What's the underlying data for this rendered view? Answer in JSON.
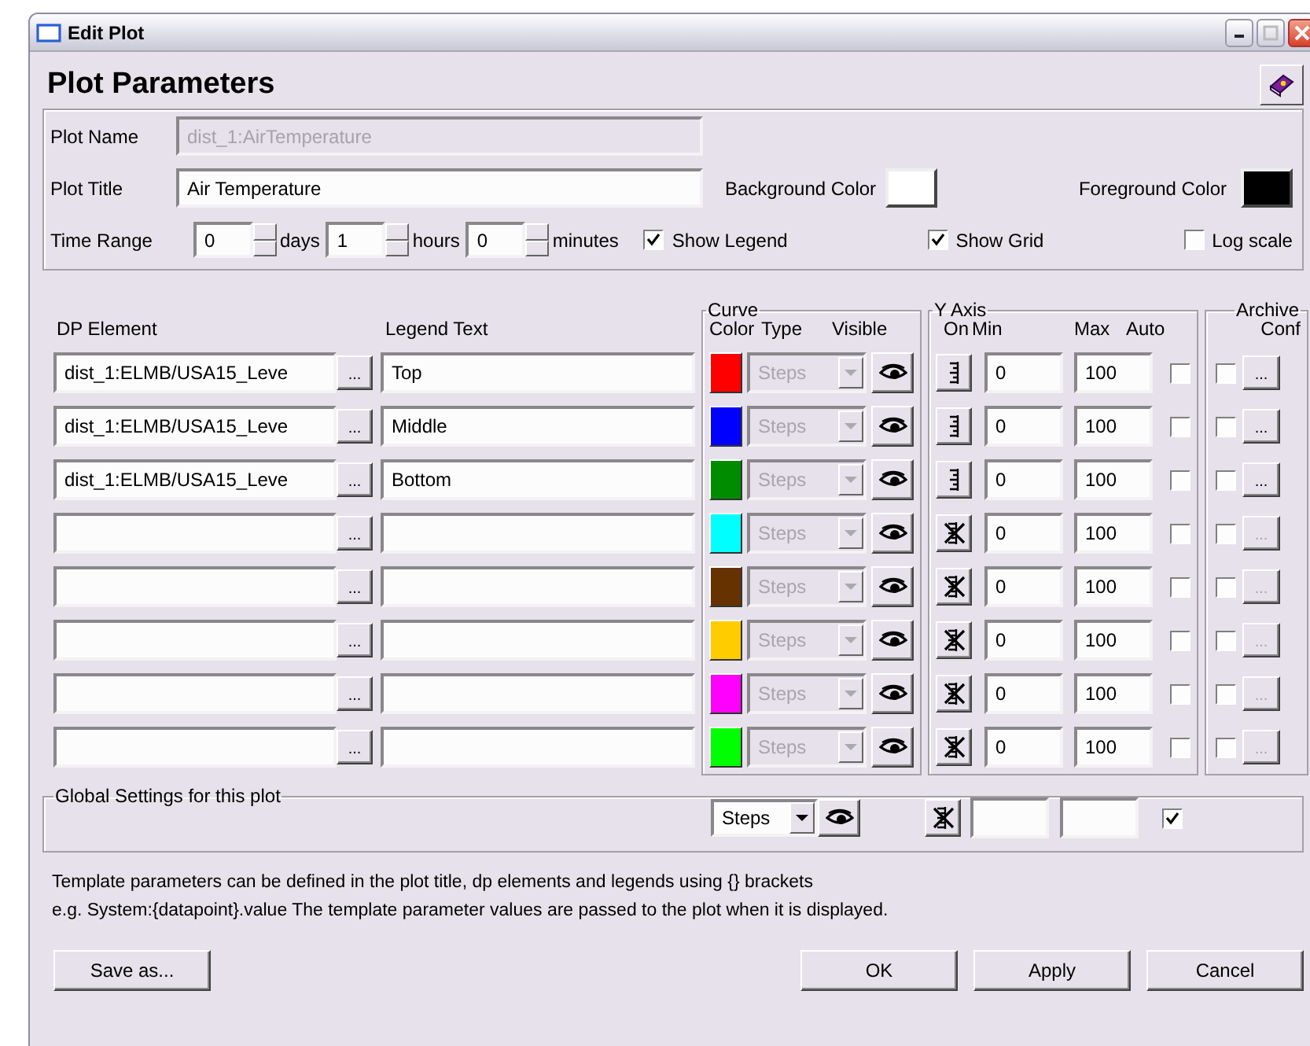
{
  "window": {
    "title": "Edit Plot"
  },
  "heading": "Plot Parameters",
  "plot_name": {
    "label": "Plot Name",
    "value": "dist_1:AirTemperature",
    "disabled": true
  },
  "plot_title": {
    "label": "Plot Title",
    "value": "Air Temperature"
  },
  "background_color": {
    "label": "Background Color",
    "color": "#ffffff"
  },
  "foreground_color": {
    "label": "Foreground Color",
    "color": "#000000"
  },
  "time_range": {
    "label": "Time Range",
    "fields": [
      {
        "value": "0",
        "unit": "days"
      },
      {
        "value": "1",
        "unit": "hours"
      },
      {
        "value": "0",
        "unit": "minutes"
      }
    ]
  },
  "options": [
    {
      "label": "Show Legend",
      "checked": true
    },
    {
      "label": "Show Grid",
      "checked": true
    },
    {
      "label": "Log scale",
      "checked": false
    }
  ],
  "columns": {
    "dp_element": "DP Element",
    "legend_text": "Legend Text",
    "curve": "Curve",
    "color_label": "Color",
    "type": "Type",
    "visible": "Visible",
    "y_axis": "Y Axis",
    "on": "On",
    "min": "Min",
    "max": "Max",
    "auto": "Auto",
    "archive": "Archive",
    "conf": "Conf"
  },
  "rows": [
    {
      "dp_element": "dist_1:ELMB/USA15_Leve",
      "dp_button": "...",
      "legend": "Top",
      "color": "#ff0000",
      "type": "Steps",
      "type_disabled": true,
      "axis_on": true,
      "min": "0",
      "max": "100",
      "auto": false,
      "archive": false,
      "conf_button": "...",
      "conf_disabled": false
    },
    {
      "dp_element": "dist_1:ELMB/USA15_Leve",
      "dp_button": "...",
      "legend": "Middle",
      "color": "#0000ff",
      "type": "Steps",
      "type_disabled": true,
      "axis_on": true,
      "min": "0",
      "max": "100",
      "auto": false,
      "archive": false,
      "conf_button": "...",
      "conf_disabled": false
    },
    {
      "dp_element": "dist_1:ELMB/USA15_Leve",
      "dp_button": "...",
      "legend": "Bottom",
      "color": "#008c00",
      "type": "Steps",
      "type_disabled": true,
      "axis_on": true,
      "min": "0",
      "max": "100",
      "auto": false,
      "archive": false,
      "conf_button": "...",
      "conf_disabled": false
    },
    {
      "dp_button": "...",
      "color": "#00ffff",
      "type": "Steps",
      "type_disabled": true,
      "axis_on": false,
      "min": "0",
      "max": "100",
      "auto": false,
      "archive": false,
      "conf_button": "...",
      "conf_disabled": true
    },
    {
      "dp_button": "...",
      "color": "#663300",
      "type": "Steps",
      "type_disabled": true,
      "axis_on": false,
      "min": "0",
      "max": "100",
      "auto": false,
      "archive": false,
      "conf_button": "...",
      "conf_disabled": true
    },
    {
      "dp_button": "...",
      "color": "#ffcc00",
      "type": "Steps",
      "type_disabled": true,
      "axis_on": false,
      "min": "0",
      "max": "100",
      "auto": false,
      "archive": false,
      "conf_button": "...",
      "conf_disabled": true
    },
    {
      "dp_button": "...",
      "color": "#ff00ff",
      "type": "Steps",
      "type_disabled": true,
      "axis_on": false,
      "min": "0",
      "max": "100",
      "auto": false,
      "archive": false,
      "conf_button": "...",
      "conf_disabled": true
    },
    {
      "dp_button": "...",
      "color": "#00ff00",
      "type": "Steps",
      "type_disabled": true,
      "axis_on": false,
      "min": "0",
      "max": "100",
      "auto": false,
      "archive": false,
      "conf_button": "...",
      "conf_disabled": true
    }
  ],
  "global": {
    "title": "Global Settings for this plot",
    "type": "Steps",
    "axis_on": false,
    "auto": true
  },
  "note": [
    "Template parameters can be defined in the plot title, dp elements and legends using {} brackets",
    "e.g. System:{datapoint}.value  The template parameter values are passed to the plot when it is displayed."
  ],
  "buttons": {
    "save_as": "Save as...",
    "ok": "OK",
    "apply": "Apply",
    "cancel": "Cancel"
  }
}
